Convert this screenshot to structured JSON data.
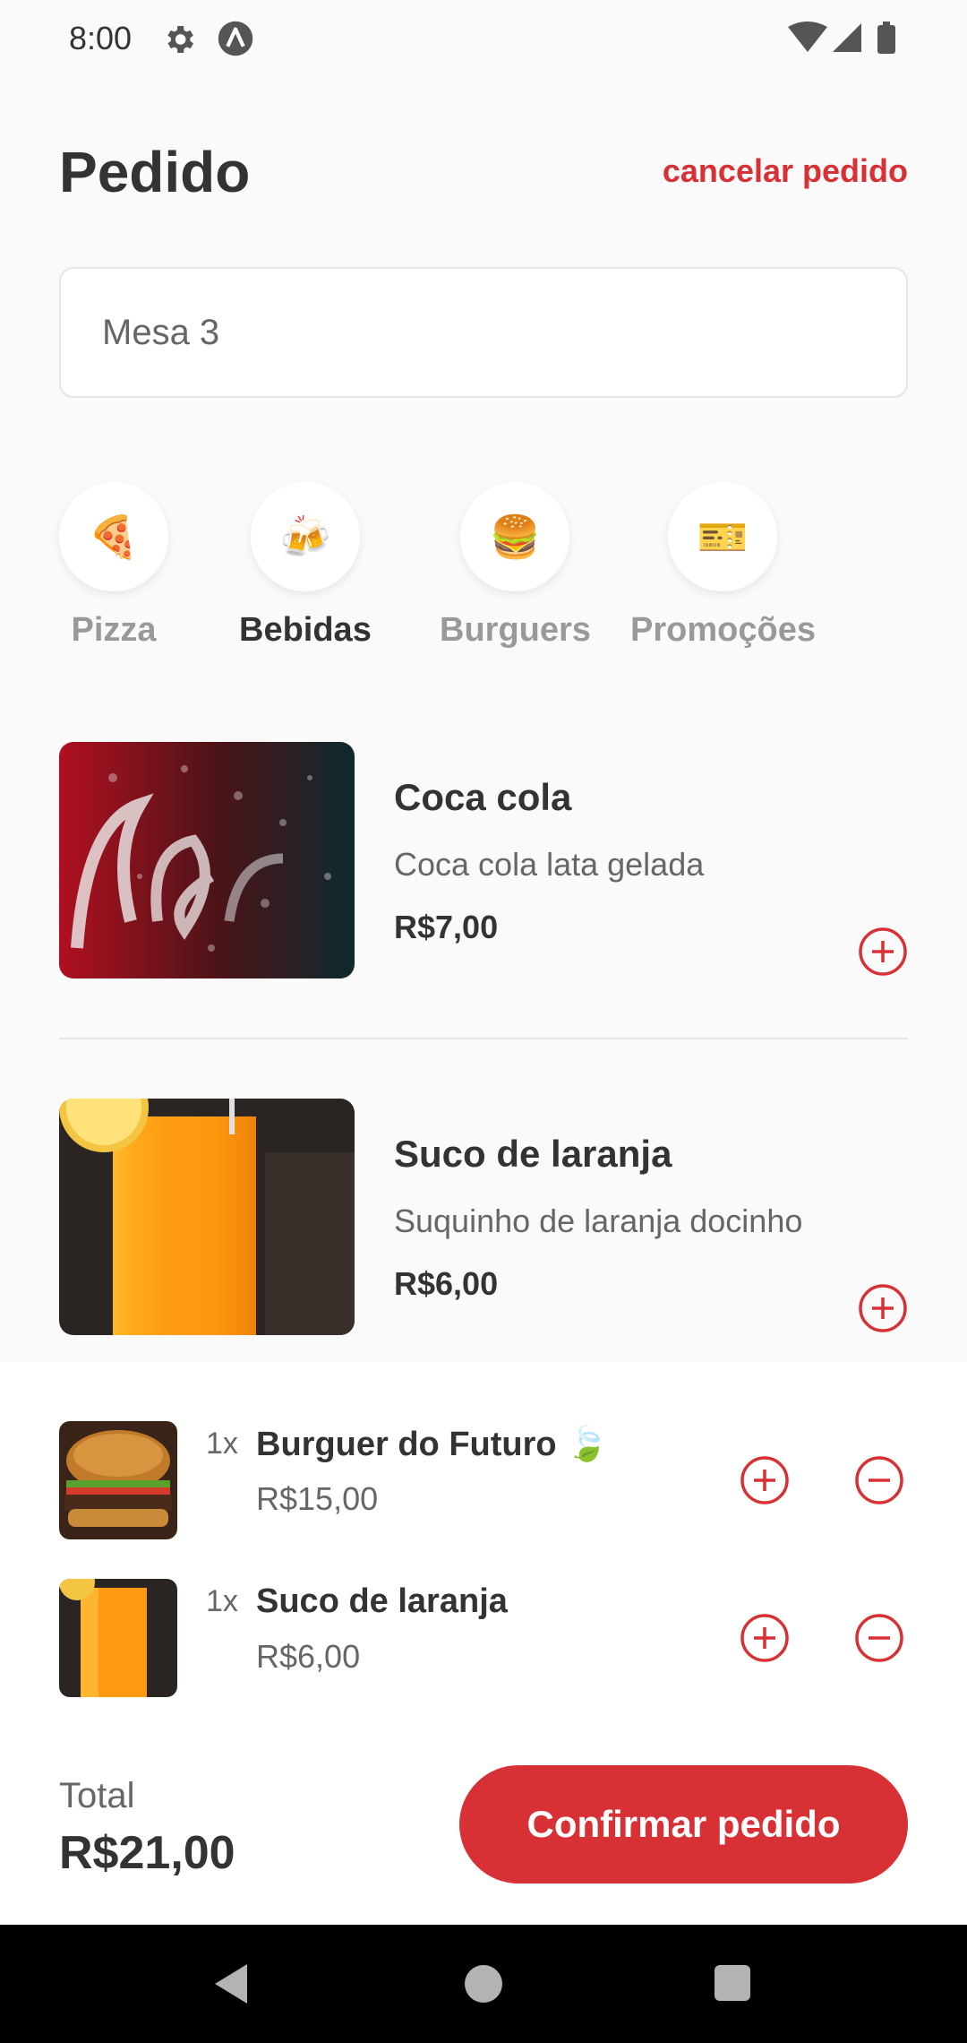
{
  "status": {
    "time": "8:00"
  },
  "header": {
    "title": "Pedido",
    "cancel_label": "cancelar pedido"
  },
  "table": {
    "value": "Mesa 3"
  },
  "categories": [
    {
      "label": "Pizza",
      "icon": "🍕",
      "active": false
    },
    {
      "label": "Bebidas",
      "icon": "🍻",
      "active": true
    },
    {
      "label": "Burguers",
      "icon": "🍔",
      "active": false
    },
    {
      "label": "Promoções",
      "icon": "🎫",
      "active": false
    }
  ],
  "menu": [
    {
      "name": "Coca cola",
      "description": "Coca cola lata gelada",
      "price": "R$7,00"
    },
    {
      "name": "Suco de laranja",
      "description": "Suquinho de laranja docinho",
      "price": "R$6,00"
    }
  ],
  "cart": [
    {
      "qty": "1x",
      "name": "Burguer do Futuro 🍃",
      "price": "R$15,00"
    },
    {
      "qty": "1x",
      "name": "Suco de laranja",
      "price": "R$6,00"
    }
  ],
  "total": {
    "label": "Total",
    "value": "R$21,00"
  },
  "confirm_label": "Confirmar pedido",
  "colors": {
    "accent": "#d73035",
    "background": "#fafafa",
    "text": "#333333",
    "muted": "#666666"
  }
}
